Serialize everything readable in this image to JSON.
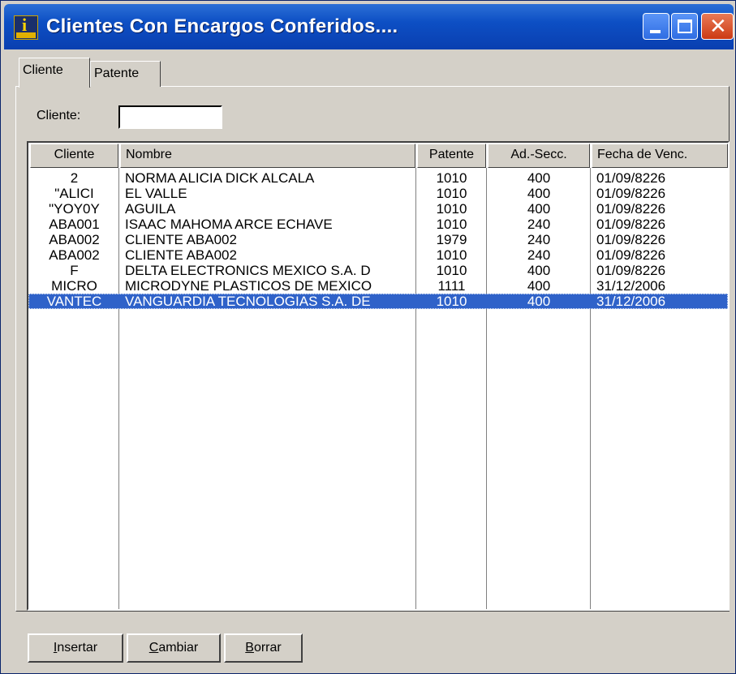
{
  "window": {
    "title": "Clientes Con Encargos Conferidos....",
    "app_icon": "wb-app-icon"
  },
  "titlebar_buttons": {
    "minimize_icon": "minimize-icon",
    "maximize_icon": "maximize-icon",
    "close_icon": "close-icon",
    "close_glyph": "✕"
  },
  "tabs": [
    {
      "label": "Cliente",
      "active": true
    },
    {
      "label": "Patente",
      "active": false
    }
  ],
  "filter": {
    "label": "Cliente:",
    "value": ""
  },
  "grid": {
    "columns": [
      "Cliente",
      "Nombre",
      "Patente",
      "Ad.-Secc.",
      "Fecha de Venc."
    ],
    "rows": [
      {
        "cliente": "2",
        "nombre": "NORMA ALICIA DICK ALCALA",
        "patente": "1010",
        "adsecc": "400",
        "fecha": "01/09/8226"
      },
      {
        "cliente": "\"ALICI",
        "nombre": "EL VALLE",
        "patente": "1010",
        "adsecc": "400",
        "fecha": "01/09/8226"
      },
      {
        "cliente": "\"YOY0Y",
        "nombre": "AGUILA",
        "patente": "1010",
        "adsecc": "400",
        "fecha": "01/09/8226"
      },
      {
        "cliente": "ABA001",
        "nombre": "ISAAC MAHOMA ARCE ECHAVE",
        "patente": "1010",
        "adsecc": "240",
        "fecha": "01/09/8226"
      },
      {
        "cliente": "ABA002",
        "nombre": "CLIENTE ABA002",
        "patente": "1979",
        "adsecc": "240",
        "fecha": "01/09/8226"
      },
      {
        "cliente": "ABA002",
        "nombre": "CLIENTE ABA002",
        "patente": "1010",
        "adsecc": "240",
        "fecha": "01/09/8226"
      },
      {
        "cliente": "F",
        "nombre": "DELTA ELECTRONICS MEXICO S.A. D",
        "patente": "1010",
        "adsecc": "400",
        "fecha": "01/09/8226"
      },
      {
        "cliente": "MICRO",
        "nombre": "MICRODYNE PLASTICOS DE MEXICO",
        "patente": "1111",
        "adsecc": "400",
        "fecha": "31/12/2006"
      },
      {
        "cliente": "VANTEC",
        "nombre": "VANGUARDIA TECNOLOGIAS S.A. DE",
        "patente": "1010",
        "adsecc": "400",
        "fecha": "31/12/2006",
        "selected": true
      }
    ]
  },
  "buttons": {
    "insertar": {
      "mnemonic": "I",
      "rest": "nsertar"
    },
    "cambiar": {
      "mnemonic": "C",
      "rest": "ambiar"
    },
    "borrar": {
      "mnemonic": "B",
      "rest": "orrar"
    }
  },
  "colors": {
    "titlebar": "#0d4fc4",
    "selection": "#2f62c9",
    "face": "#d4d0c8",
    "close_button": "#cc3a14"
  }
}
